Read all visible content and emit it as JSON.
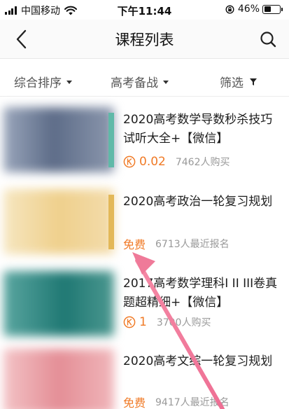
{
  "status_bar": {
    "carrier": "中国移动",
    "time": "下午11:44",
    "battery": "46%",
    "battery_level": 0.46
  },
  "nav": {
    "title": "课程列表"
  },
  "filters": [
    {
      "label": "综合排序"
    },
    {
      "label": "高考备战"
    },
    {
      "label": "筛选"
    }
  ],
  "courses": [
    {
      "title": "2020高考数学导数秒杀技巧试听大全+【微信】",
      "price": "0.02",
      "count": "7462人购买"
    },
    {
      "title": "2020高考政治一轮复习规划",
      "price": "免费",
      "count": "6713人最近报名"
    },
    {
      "title": "2017高考数学理科I II III卷真题超精细+【微信】",
      "price": "1",
      "count": "3700人购买"
    },
    {
      "title": "2020高考文综一轮复习规划",
      "price": "免费",
      "count": "9417人最近报名"
    }
  ],
  "colors": {
    "accent": "#f07a26",
    "annotation_arrow": "#f0789a",
    "thumb_1": "#6f7f9a",
    "thumb_2": "#f1d8a0",
    "thumb_3": "#2f8a86",
    "thumb_4": "#e8a0a6"
  }
}
